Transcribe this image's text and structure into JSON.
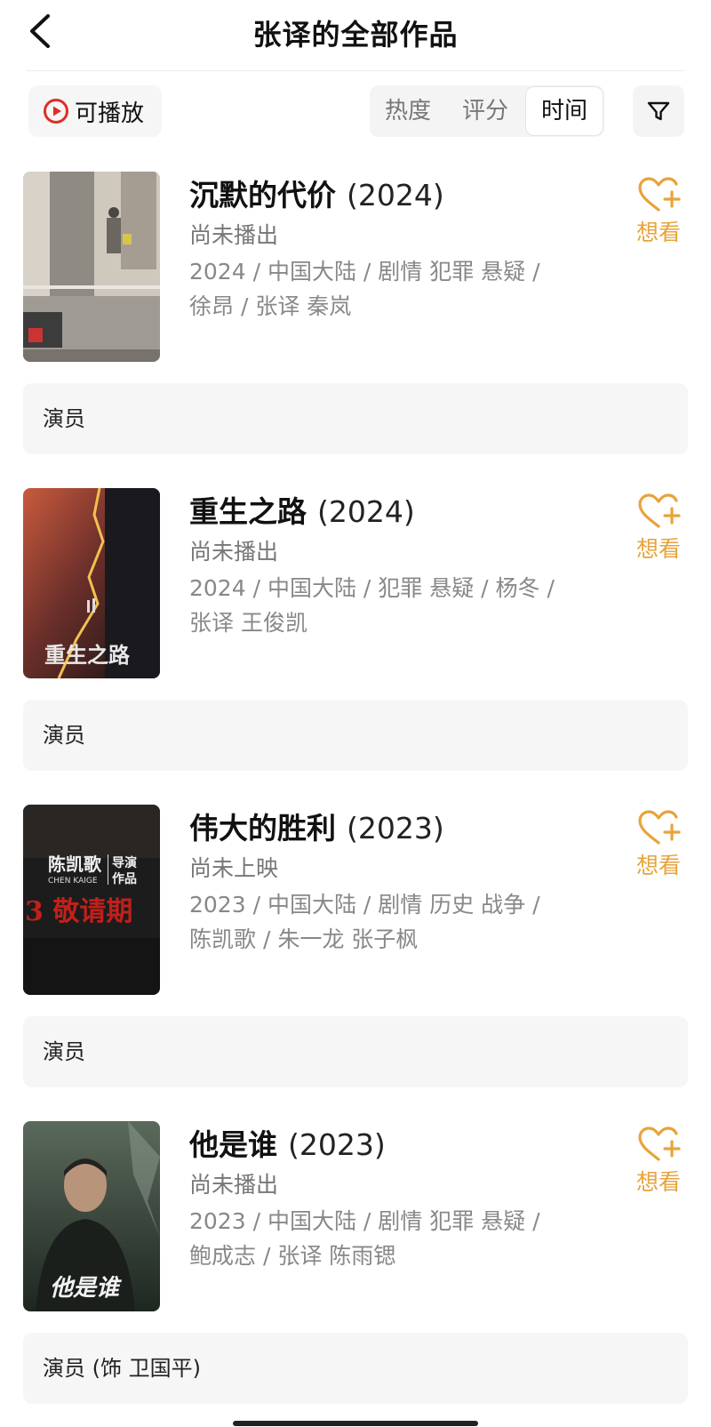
{
  "header": {
    "title": "张译的全部作品",
    "back_icon": "chevron-left-icon"
  },
  "toolbar": {
    "playable_label": "可播放",
    "playable_icon": "play-circle-icon",
    "sort_tabs": [
      {
        "label": "热度",
        "selected": false
      },
      {
        "label": "评分",
        "selected": false
      },
      {
        "label": "时间",
        "selected": true
      }
    ],
    "filter_icon": "filter-icon"
  },
  "colors": {
    "accent": "#e8a33a",
    "play_red": "#e02e24"
  },
  "works": [
    {
      "title": "沉默的代价",
      "year": "(2024)",
      "status": "尚未播出",
      "meta_line1": "2024 / 中国大陆 / 剧情 犯罪 悬疑 /",
      "meta_line2": "徐昂 / 张译 秦岚",
      "want_label": "想看",
      "role": "演员"
    },
    {
      "title": "重生之路",
      "year": "(2024)",
      "status": "尚未播出",
      "meta_line1": "2024 / 中国大陆 / 犯罪 悬疑 / 杨冬 /",
      "meta_line2": "张译 王俊凯",
      "want_label": "想看",
      "role": "演员",
      "poster_text": "重生之路"
    },
    {
      "title": "伟大的胜利",
      "year": "(2023)",
      "status": "尚未上映",
      "meta_line1": "2023 / 中国大陆 / 剧情 历史 战争 /",
      "meta_line2": "陈凯歌 / 朱一龙 张子枫",
      "want_label": "想看",
      "role": "演员",
      "poster_director": "陈凯歌",
      "poster_director_en": "CHEN KAIGE",
      "poster_tag1": "导演",
      "poster_tag2": "作品",
      "poster_red": "3 敬请期"
    },
    {
      "title": "他是谁",
      "year": "(2023)",
      "status": "尚未播出",
      "meta_line1": "2023 / 中国大陆 / 剧情 犯罪 悬疑 /",
      "meta_line2": "鲍成志 / 张译 陈雨锶",
      "want_label": "想看",
      "role": "演员 (饰 卫国平)",
      "poster_text": "他是谁"
    }
  ]
}
